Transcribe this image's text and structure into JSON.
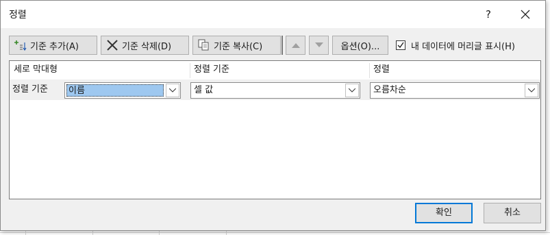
{
  "dialog": {
    "title": "정렬",
    "help_label": "?"
  },
  "toolbar": {
    "add_level": "기준 추가(A)",
    "delete_level": "기준 삭제(D)",
    "copy_level": "기준 복사(C)",
    "options": "옵션(O)...",
    "header_checkbox_label": "내 데이터에 머리글 표시(H)",
    "header_checkbox_checked": true,
    "move_up_icon": "up-arrow",
    "move_down_icon": "down-arrow"
  },
  "grid": {
    "columns": [
      "세로 막대형",
      "정렬 기준",
      "정렬"
    ],
    "rows": [
      {
        "label": "정렬 기준",
        "column": "이름",
        "sort_on": "셀 값",
        "order": "오름차순"
      }
    ]
  },
  "footer": {
    "ok": "확인",
    "cancel": "취소"
  },
  "colors": {
    "accent": "#0078d7",
    "selection": "#9ec8f0"
  }
}
